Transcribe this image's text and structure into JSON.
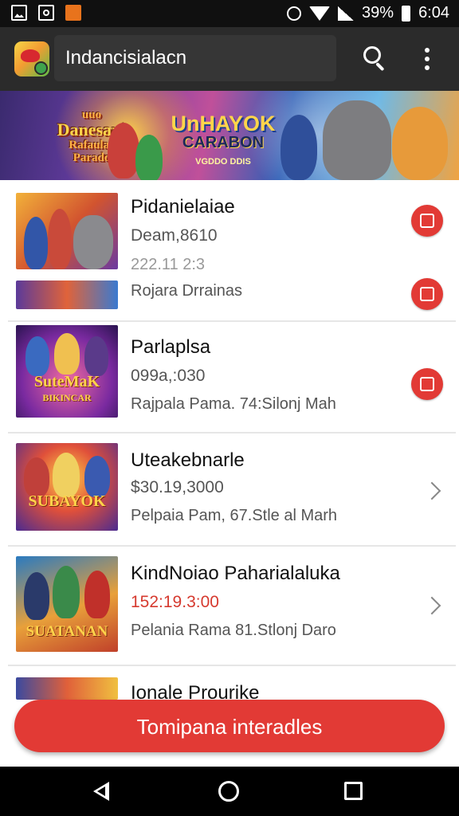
{
  "status_bar": {
    "battery_text": "39%",
    "time": "6:04"
  },
  "app_bar": {
    "title": "Indancisialacn",
    "icons": [
      "app-logo",
      "search-icon",
      "more-vert-icon"
    ]
  },
  "banner": {
    "left_title": [
      "Danesani",
      "Rafaulac",
      "Parado"
    ],
    "left_small": "uuo",
    "center_title": "UnHAYOK",
    "center_sub": "CARABON",
    "center_tiny": "VGDDO DDIS"
  },
  "items": [
    {
      "title": "Pidanielaiae",
      "line2": "Deam,8610",
      "line3": "222.11 2:3",
      "thumb_caption": "",
      "action": "red-square-icon"
    },
    {
      "title": "",
      "line2": "",
      "line3": "Rojara Drrainas",
      "thumb_caption": "",
      "action": "red-square-icon"
    },
    {
      "title": "Parlaplsa",
      "line2": "099a,:030",
      "line3": "Rajpala Pama. 74:Silonj Mah",
      "thumb_caption": "SuteMaK",
      "thumb_sub": "BIKINCAR",
      "action": "red-square-icon"
    },
    {
      "title": "Uteakebnarle",
      "line2": "$30.19,3000",
      "line3": "Pelpaia Pam, 67.Stle al Marh",
      "thumb_caption": "SUBAYOK",
      "action": "chevron-right-icon"
    },
    {
      "title": "KindNoiao Paharialaluka",
      "line2": "152:19.3:00",
      "line3": "Pelania Rama 81.Stlonj Daro",
      "thumb_caption": "SUATANAN",
      "action": "chevron-right-icon"
    },
    {
      "title": "Ionale Prourike",
      "line2": "",
      "line3": "",
      "thumb_caption": "",
      "action": ""
    }
  ],
  "cta": {
    "label": "Tomipana interadles"
  },
  "colors": {
    "accent": "#e23a35",
    "app_bar": "#2b2b2b",
    "price_red": "#d63a2f"
  },
  "nav_bar": {
    "icons": [
      "back-icon",
      "home-icon",
      "recent-apps-icon"
    ]
  }
}
